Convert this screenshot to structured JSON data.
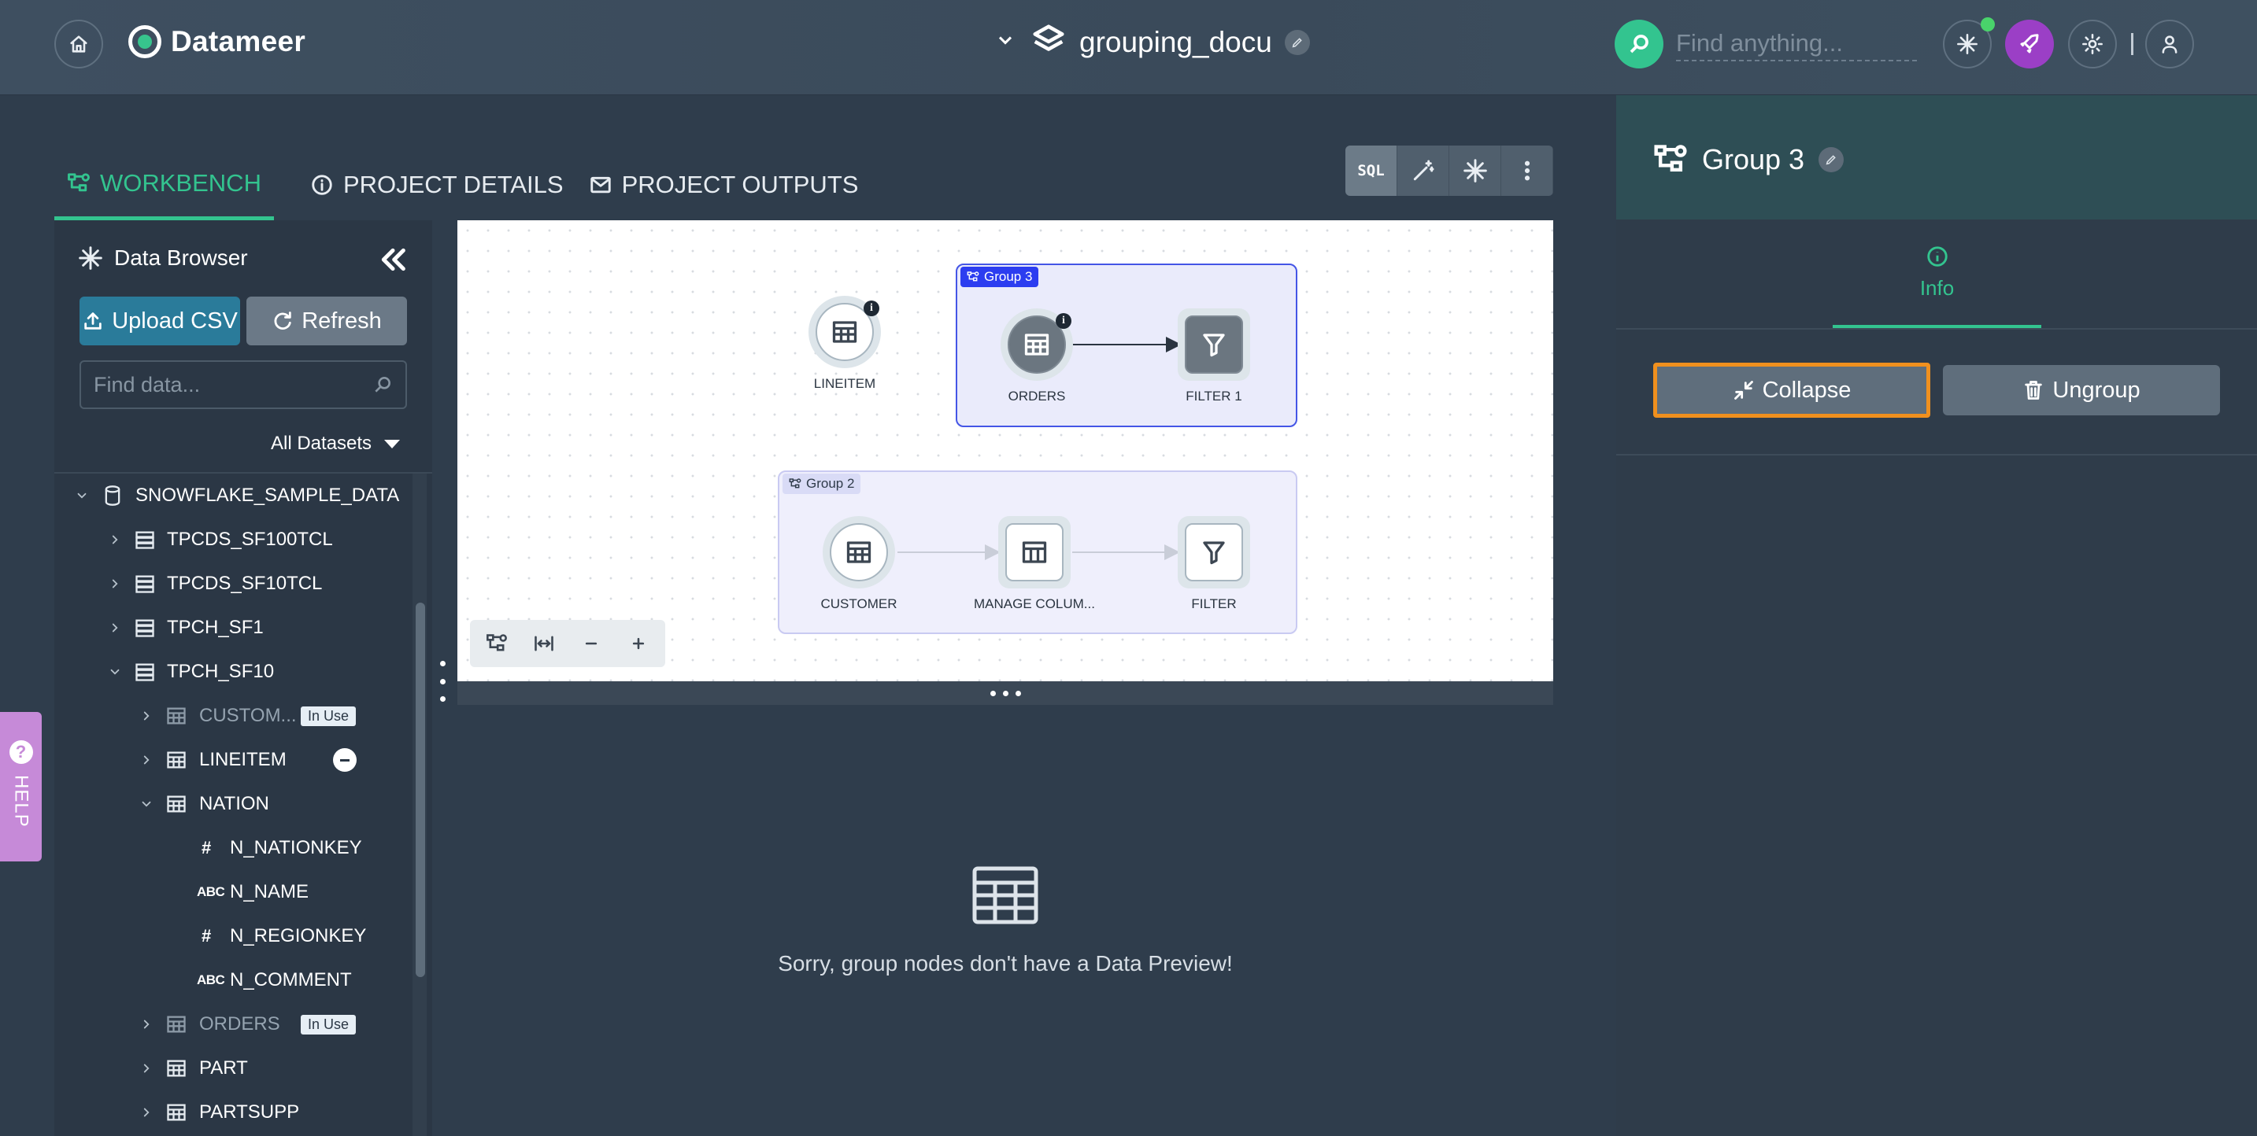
{
  "header": {
    "brand": "Datameer",
    "project_name": "grouping_docu",
    "search_placeholder": "Find anything..."
  },
  "tabs": [
    {
      "label": "WORKBENCH",
      "active": true
    },
    {
      "label": "PROJECT DETAILS",
      "active": false
    },
    {
      "label": "PROJECT OUTPUTS",
      "active": false
    }
  ],
  "toolbar": {
    "sql_label": "SQL"
  },
  "data_browser": {
    "title": "Data Browser",
    "upload_label": "Upload CSV",
    "refresh_label": "Refresh",
    "find_placeholder": "Find data...",
    "filter_label": "All Datasets",
    "tree": [
      {
        "label": "SNOWFLAKE_SAMPLE_DATA",
        "level": 0,
        "expanded": true,
        "icon": "database-icon"
      },
      {
        "label": "TPCDS_SF100TCL",
        "level": 1,
        "expanded": false,
        "icon": "schema-icon"
      },
      {
        "label": "TPCDS_SF10TCL",
        "level": 1,
        "expanded": false,
        "icon": "schema-icon"
      },
      {
        "label": "TPCH_SF1",
        "level": 1,
        "expanded": false,
        "icon": "schema-icon"
      },
      {
        "label": "TPCH_SF10",
        "level": 1,
        "expanded": true,
        "icon": "schema-icon"
      },
      {
        "label": "CUSTOM...",
        "level": 2,
        "expanded": false,
        "icon": "table-icon",
        "badge": "In Use",
        "muted": true
      },
      {
        "label": "LINEITEM",
        "level": 2,
        "expanded": false,
        "icon": "table-icon",
        "remove": true
      },
      {
        "label": "NATION",
        "level": 2,
        "expanded": true,
        "icon": "table-icon"
      },
      {
        "label": "N_NATIONKEY",
        "level": 3,
        "type": "#"
      },
      {
        "label": "N_NAME",
        "level": 3,
        "type": "ABC"
      },
      {
        "label": "N_REGIONKEY",
        "level": 3,
        "type": "#"
      },
      {
        "label": "N_COMMENT",
        "level": 3,
        "type": "ABC"
      },
      {
        "label": "ORDERS",
        "level": 2,
        "expanded": false,
        "icon": "table-icon",
        "badge": "In Use",
        "muted": true
      },
      {
        "label": "PART",
        "level": 2,
        "expanded": false,
        "icon": "table-icon"
      },
      {
        "label": "PARTSUPP",
        "level": 2,
        "expanded": false,
        "icon": "table-icon"
      }
    ]
  },
  "help_label": "HELP",
  "canvas": {
    "groups": [
      {
        "name": "Group 3",
        "selected": true
      },
      {
        "name": "Group 2",
        "selected": false
      }
    ],
    "nodes": {
      "lineitem": "LINEITEM",
      "orders": "ORDERS",
      "filter1": "FILTER 1",
      "customer": "CUSTOMER",
      "manage": "MANAGE COLUM...",
      "filter": "FILTER"
    }
  },
  "preview": {
    "message": "Sorry, group nodes don't have a Data Preview!"
  },
  "right_panel": {
    "title": "Group 3",
    "tab_label": "Info",
    "collapse_label": "Collapse",
    "ungroup_label": "Ungroup"
  },
  "colors": {
    "accent": "#33c48f",
    "primary_button": "#2a7b9a",
    "selected_group": "#2c3df0",
    "focus_outline": "#f0901e",
    "help": "#c68ad8"
  }
}
